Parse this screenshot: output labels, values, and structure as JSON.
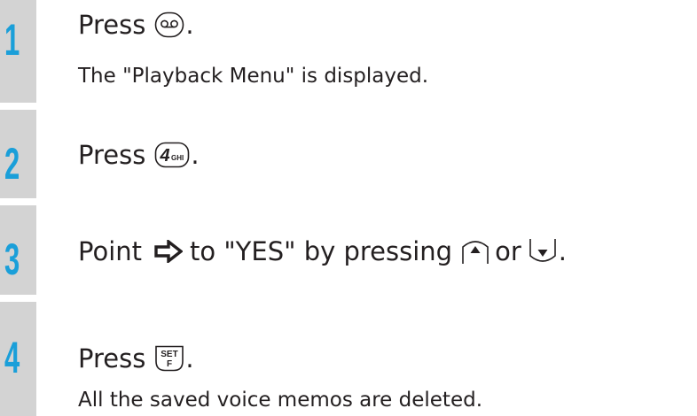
{
  "steps": [
    {
      "number": "1",
      "before": "Press",
      "after": ".",
      "key_icon": "voicemail-key-icon",
      "description": "The \"Playback Menu\" is displayed."
    },
    {
      "number": "2",
      "before": "Press",
      "after": ".",
      "key_icon": "4ghi-key-icon",
      "key_text_digit": "4",
      "key_text_letters": "GHI"
    },
    {
      "number": "3",
      "part1": "Point",
      "part2": "to \"YES\" by pressing",
      "part3": "or",
      "after": ".",
      "icons": [
        "pointer-arrow-icon",
        "up-key-icon",
        "down-key-icon"
      ]
    },
    {
      "number": "4",
      "before": "Press",
      "after": ".",
      "key_icon": "set-f-key-icon",
      "key_text_top": "SET",
      "key_text_bottom": "F",
      "description": "All the saved voice memos are deleted."
    }
  ],
  "colors": {
    "step_number": "#1a9fd9",
    "step_bar": "#d3d3d3",
    "text": "#231f20"
  }
}
